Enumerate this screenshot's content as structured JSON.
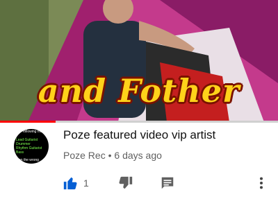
{
  "video": {
    "caption": "and Fother",
    "progress": 0.2
  },
  "channel": {
    "avatar_lines": {
      "top": "following me",
      "roles": [
        "Lead Guitarist",
        "Drummer",
        "Rhythm Guitarist",
        "Bass"
      ],
      "bottom": "on the wrong"
    }
  },
  "info": {
    "title": "Poze featured video vip artist",
    "channel_name": "Poze Rec",
    "separator": "•",
    "age": "6 days ago"
  },
  "actions": {
    "like_count": "1",
    "icons": [
      "thumbs-up-icon",
      "thumbs-down-icon",
      "comment-icon",
      "more-vert-icon"
    ]
  },
  "colors": {
    "accent": "#ff0000",
    "like_active": "#065fd4",
    "icon_gray": "#606060",
    "caption_fill": "#ffd21a",
    "caption_outline": "#7a1200"
  }
}
